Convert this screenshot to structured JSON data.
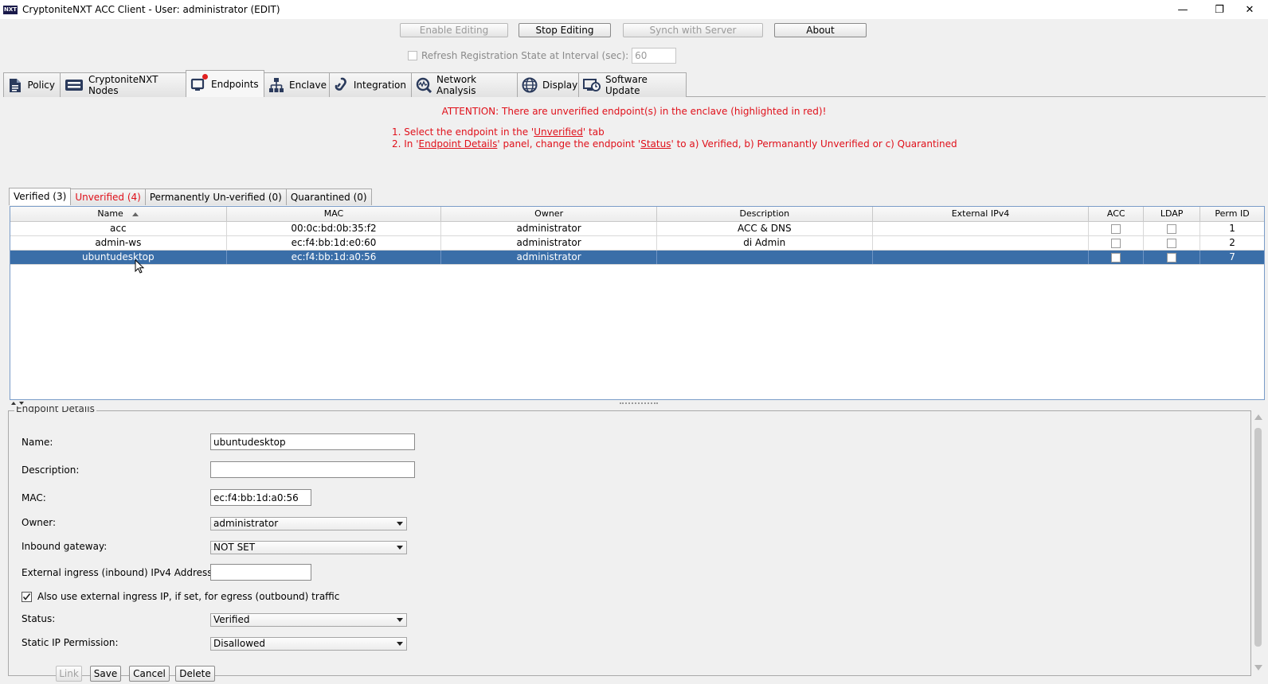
{
  "window": {
    "logo_text": "NXT",
    "title": "CryptoniteNXT ACC Client - User: administrator (EDIT)",
    "minimize": "—",
    "restore": "❐",
    "close": "✕"
  },
  "toolbar": {
    "enable_editing": "Enable Editing",
    "stop_editing": "Stop Editing",
    "synch": "Synch with Server",
    "about": "About",
    "refresh_label": "Refresh Registration State at Interval (sec):",
    "refresh_value": "60"
  },
  "tabs": [
    {
      "label": "Policy",
      "icon": "document-icon"
    },
    {
      "label": "CryptoniteNXT Nodes",
      "icon": "server-icon"
    },
    {
      "label": "Endpoints",
      "icon": "endpoint-icon"
    },
    {
      "label": "Enclave",
      "icon": "network-tree-icon"
    },
    {
      "label": "Integration",
      "icon": "link-icon"
    },
    {
      "label": "Network Analysis",
      "icon": "analysis-icon"
    },
    {
      "label": "Display",
      "icon": "globe-icon"
    },
    {
      "label": "Software Update",
      "icon": "update-icon"
    }
  ],
  "attention": {
    "message": "ATTENTION: There are unverified endpoint(s) in the enclave (highlighted in red)!",
    "step1_pre": "1. Select the endpoint in the '",
    "step1_link": "Unverified",
    "step1_post": "' tab",
    "step2_pre": "2. In '",
    "step2_link1": "Endpoint Details",
    "step2_mid": "' panel, change the endpoint '",
    "step2_link2": "Status",
    "step2_post": "' to a) Verified, b) Permanantly Unverified or c) Quarantined"
  },
  "subtabs": [
    {
      "label": "Verified (3)"
    },
    {
      "label": "Unverified (4)"
    },
    {
      "label": "Permanently Un-verified (0)"
    },
    {
      "label": "Quarantined (0)"
    }
  ],
  "table": {
    "columns": [
      "Name",
      "MAC",
      "Owner",
      "Description",
      "External IPv4",
      "ACC",
      "LDAP",
      "Perm ID"
    ],
    "rows": [
      {
        "name": "acc",
        "mac": "00:0c:bd:0b:35:f2",
        "owner": "administrator",
        "description": "ACC & DNS",
        "ext": "",
        "perm": "1"
      },
      {
        "name": "admin-ws",
        "mac": "ec:f4:bb:1d:e0:60",
        "owner": "administrator",
        "description": "di Admin",
        "ext": "",
        "perm": "2"
      },
      {
        "name": "ubuntudesktop",
        "mac": "ec:f4:bb:1d:a0:56",
        "owner": "administrator",
        "description": "",
        "ext": "",
        "perm": "7"
      }
    ]
  },
  "details": {
    "legend": "Endpoint Details",
    "name_label": "Name:",
    "name_value": "ubuntudesktop",
    "desc_label": "Description:",
    "desc_value": "",
    "mac_label": "MAC:",
    "mac_value": "ec:f4:bb:1d:a0:56",
    "owner_label": "Owner:",
    "owner_value": "administrator",
    "gateway_label": "Inbound gateway:",
    "gateway_value": "NOT SET",
    "ext_ip_label": "External ingress (inbound) IPv4 Address:",
    "ext_ip_value": "",
    "egress_label": "Also use external ingress IP, if set, for egress (outbound) traffic",
    "status_label": "Status:",
    "status_value": "Verified",
    "static_label": "Static IP Permission:",
    "static_value": "Disallowed",
    "link_btn": "Link",
    "save_btn": "Save",
    "cancel_btn": "Cancel",
    "delete_btn": "Delete"
  }
}
